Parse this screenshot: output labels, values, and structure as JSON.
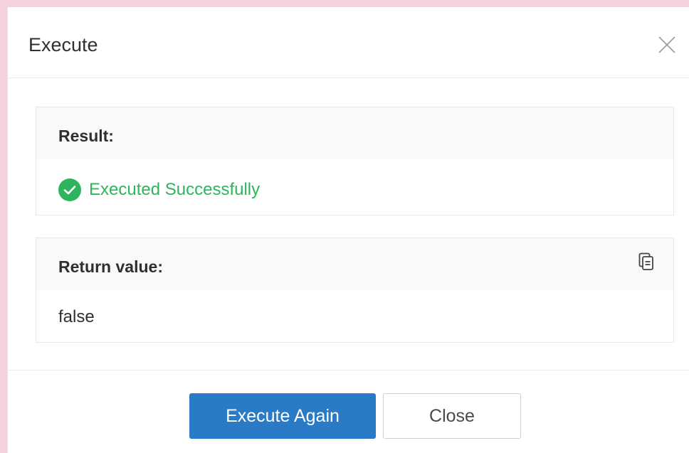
{
  "modal": {
    "title": "Execute",
    "close_icon": "close-icon"
  },
  "result": {
    "label": "Result:",
    "status_text": "Executed Successfully",
    "status_icon": "check-circle-icon",
    "status_color": "#2fb45e"
  },
  "return_value": {
    "label": "Return value:",
    "value": "false",
    "copy_icon": "copy-icon"
  },
  "footer": {
    "execute_again_label": "Execute Again",
    "close_label": "Close",
    "primary_color": "#2a7ac5"
  }
}
